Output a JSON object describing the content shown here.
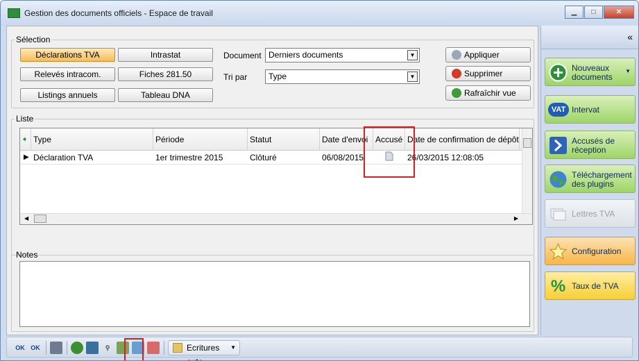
{
  "window": {
    "title": "Gestion des documents officiels - Espace de travail"
  },
  "selection": {
    "legend": "Sélection",
    "buttons": [
      "Déclarations TVA",
      "Intrastat",
      "Relevés intracom.",
      "Fiches 281.50",
      "Listings annuels",
      "Tableau DNA"
    ],
    "document_label": "Document",
    "document_value": "Derniers documents",
    "tri_label": "Tri par",
    "tri_value": "Type",
    "apply": "Appliquer",
    "delete": "Supprimer",
    "refresh": "Rafraîchir vue"
  },
  "list": {
    "legend": "Liste",
    "columns": [
      "Type",
      "Période",
      "Statut",
      "Date d'envoi",
      "Accusé",
      "Date de confirmation de dépôt"
    ],
    "rows": [
      {
        "type": "Déclaration TVA",
        "periode": "1er trimestre 2015",
        "statut": "Clôturé",
        "date_envoi": "06/08/2015",
        "confirmation": "26/03/2015 12:08:05"
      }
    ]
  },
  "notes": {
    "legend": "Notes"
  },
  "toolbar": {
    "ok1": "OK",
    "ok2": "OK",
    "ecritures": "Ecritures auto."
  },
  "sidebar": {
    "collapse": "«",
    "items": [
      {
        "label": "Nouveaux\ndocuments",
        "icon": "plus-icon"
      },
      {
        "label": "Intervat",
        "icon": "vat-icon"
      },
      {
        "label": "Accusés de\nréception",
        "icon": "arrow-down-icon"
      },
      {
        "label": "Téléchargement\ndes plugins",
        "icon": "globe-icon"
      },
      {
        "label": "Lettres TVA",
        "icon": "letters-icon"
      },
      {
        "label": "Configuration",
        "icon": "star-icon"
      },
      {
        "label": "Taux de TVA",
        "icon": "percent-icon"
      }
    ],
    "vat_badge": "VAT"
  },
  "colors": {
    "active": "#f6bd57",
    "green": "#9ed46a",
    "highlight": "#d81e1e"
  }
}
